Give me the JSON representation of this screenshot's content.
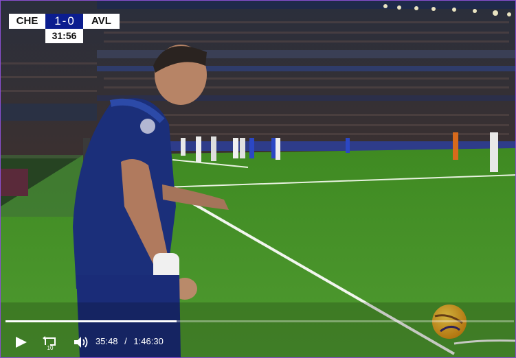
{
  "scoreboard": {
    "home_team": "CHE",
    "away_team": "AVL",
    "home_score": "1",
    "score_separator": "-",
    "away_score": "0",
    "match_clock": "31:56"
  },
  "player": {
    "current_time": "35:48",
    "time_separator": "/",
    "duration": "1:46:30",
    "progress_fraction": 0.336,
    "replay_seconds": "10"
  },
  "colors": {
    "scoreboard_blue": "#0b1d8f",
    "pitch_green": "#4a8f2a",
    "accent_border": "#8a4fd0"
  },
  "icons": [
    "play-icon",
    "replay-10-icon",
    "volume-icon"
  ]
}
